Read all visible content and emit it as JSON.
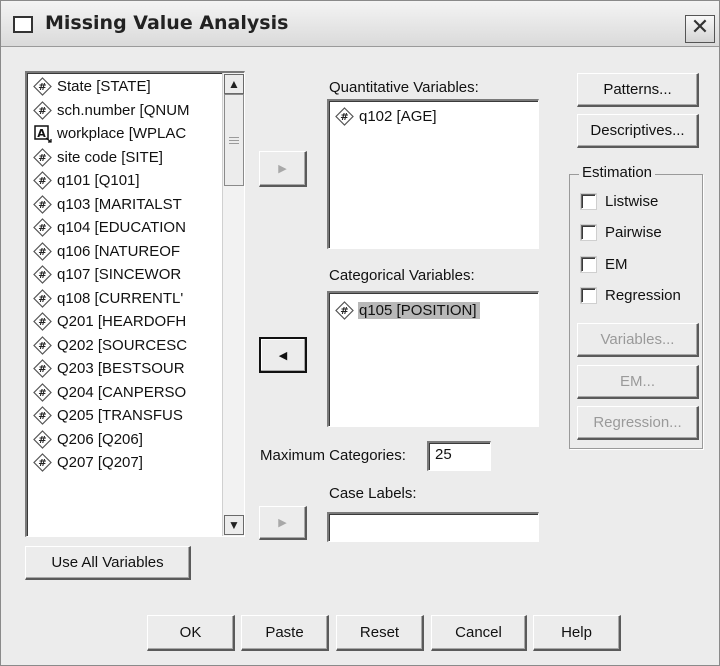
{
  "window": {
    "title": "Missing Value Analysis",
    "close_glyph": "✕"
  },
  "variables": [
    {
      "label": "State [STATE]",
      "icon": "scale-variable-icon"
    },
    {
      "label": "sch.number [QNUM",
      "icon": "scale-variable-icon"
    },
    {
      "label": "workplace [WPLAC",
      "icon": "string-variable-icon"
    },
    {
      "label": "site code [SITE]",
      "icon": "scale-variable-icon"
    },
    {
      "label": "q101 [Q101]",
      "icon": "scale-variable-icon"
    },
    {
      "label": "q103 [MARITALST",
      "icon": "scale-variable-icon"
    },
    {
      "label": "q104 [EDUCATION",
      "icon": "scale-variable-icon"
    },
    {
      "label": "q106 [NATUREOF",
      "icon": "scale-variable-icon"
    },
    {
      "label": "q107 [SINCEWOR",
      "icon": "scale-variable-icon"
    },
    {
      "label": "q108 [CURRENTL'",
      "icon": "scale-variable-icon"
    },
    {
      "label": "Q201 [HEARDOFH",
      "icon": "scale-variable-icon"
    },
    {
      "label": "Q202 [SOURCESC",
      "icon": "scale-variable-icon"
    },
    {
      "label": "Q203 [BESTSOUR",
      "icon": "scale-variable-icon"
    },
    {
      "label": "Q204 [CANPERSO",
      "icon": "scale-variable-icon"
    },
    {
      "label": "Q205 [TRANSFUS",
      "icon": "scale-variable-icon"
    },
    {
      "label": "Q206 [Q206]",
      "icon": "scale-variable-icon"
    },
    {
      "label": "Q207 [Q207]",
      "icon": "scale-variable-icon"
    }
  ],
  "quantitative": {
    "label": "Quantitative Variables:",
    "items": [
      {
        "label": "q102 [AGE]",
        "icon": "scale-variable-icon"
      }
    ]
  },
  "categorical": {
    "label": "Categorical Variables:",
    "items": [
      {
        "label": "q105 [POSITION]",
        "icon": "scale-variable-icon",
        "selected": true
      }
    ]
  },
  "max_categories": {
    "label": "Maximum Categories:",
    "value": "25"
  },
  "case_labels": {
    "label": "Case Labels:",
    "value": ""
  },
  "buttons": {
    "patterns": "Patterns...",
    "descriptives": "Descriptives...",
    "variables": "Variables...",
    "em": "EM...",
    "regression": "Regression...",
    "use_all": "Use All Variables",
    "ok": "OK",
    "paste": "Paste",
    "reset": "Reset",
    "cancel": "Cancel",
    "help": "Help"
  },
  "estimation": {
    "title": "Estimation",
    "options": [
      {
        "label": "Listwise",
        "checked": false
      },
      {
        "label": "Pairwise",
        "checked": false
      },
      {
        "label": "EM",
        "checked": false
      },
      {
        "label": "Regression",
        "checked": false
      }
    ]
  },
  "arrows": {
    "right": "▶",
    "left": "◀",
    "up": "▲",
    "down": "▼"
  }
}
